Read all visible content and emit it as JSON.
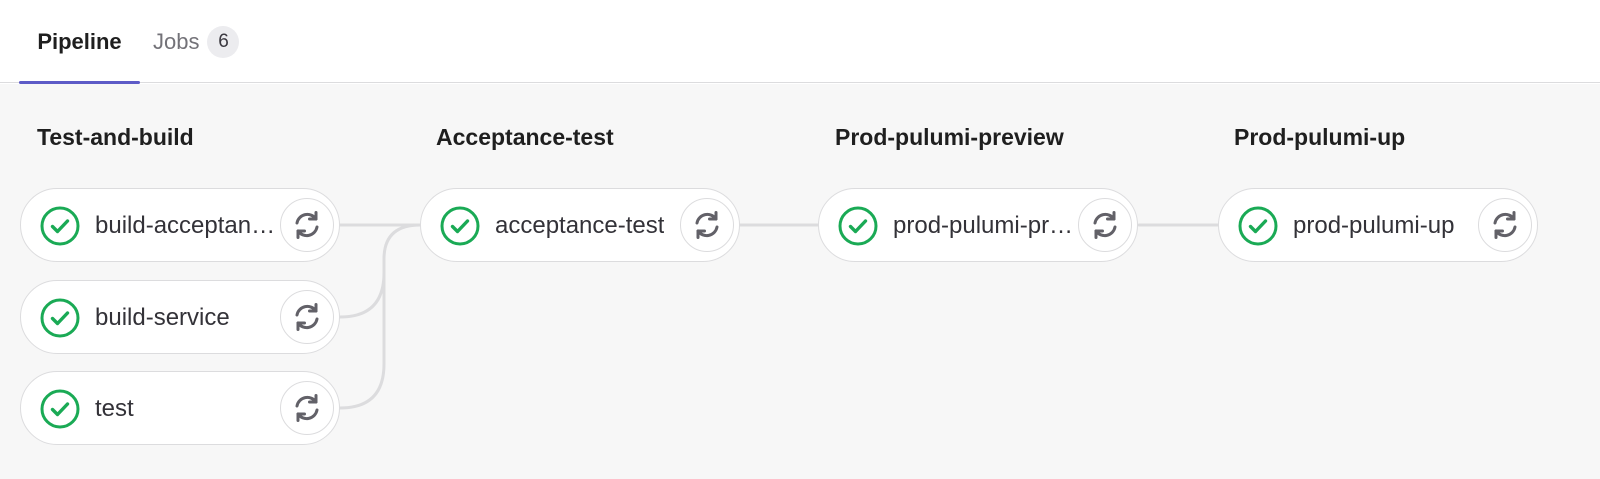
{
  "tabs": {
    "pipeline": {
      "label": "Pipeline",
      "active": true
    },
    "jobs": {
      "label": "Jobs",
      "count": "6"
    }
  },
  "colors": {
    "accent": "#5d5bc7",
    "success": "#1aaa55",
    "retry_icon": "#626168",
    "connector": "#dcdcde"
  },
  "icons": {
    "status": "check-circle-icon",
    "retry": "retry-icon"
  },
  "stages": [
    {
      "title": "Test-and-build",
      "jobs": [
        {
          "name": "build-acceptan…",
          "status": "success"
        },
        {
          "name": "build-service",
          "status": "success"
        },
        {
          "name": "test",
          "status": "success"
        }
      ]
    },
    {
      "title": "Acceptance-test",
      "jobs": [
        {
          "name": "acceptance-test",
          "status": "success"
        }
      ]
    },
    {
      "title": "Prod-pulumi-preview",
      "jobs": [
        {
          "name": "prod-pulumi-pr…",
          "status": "success"
        }
      ]
    },
    {
      "title": "Prod-pulumi-up",
      "jobs": [
        {
          "name": "prod-pulumi-up",
          "status": "success"
        }
      ]
    }
  ]
}
